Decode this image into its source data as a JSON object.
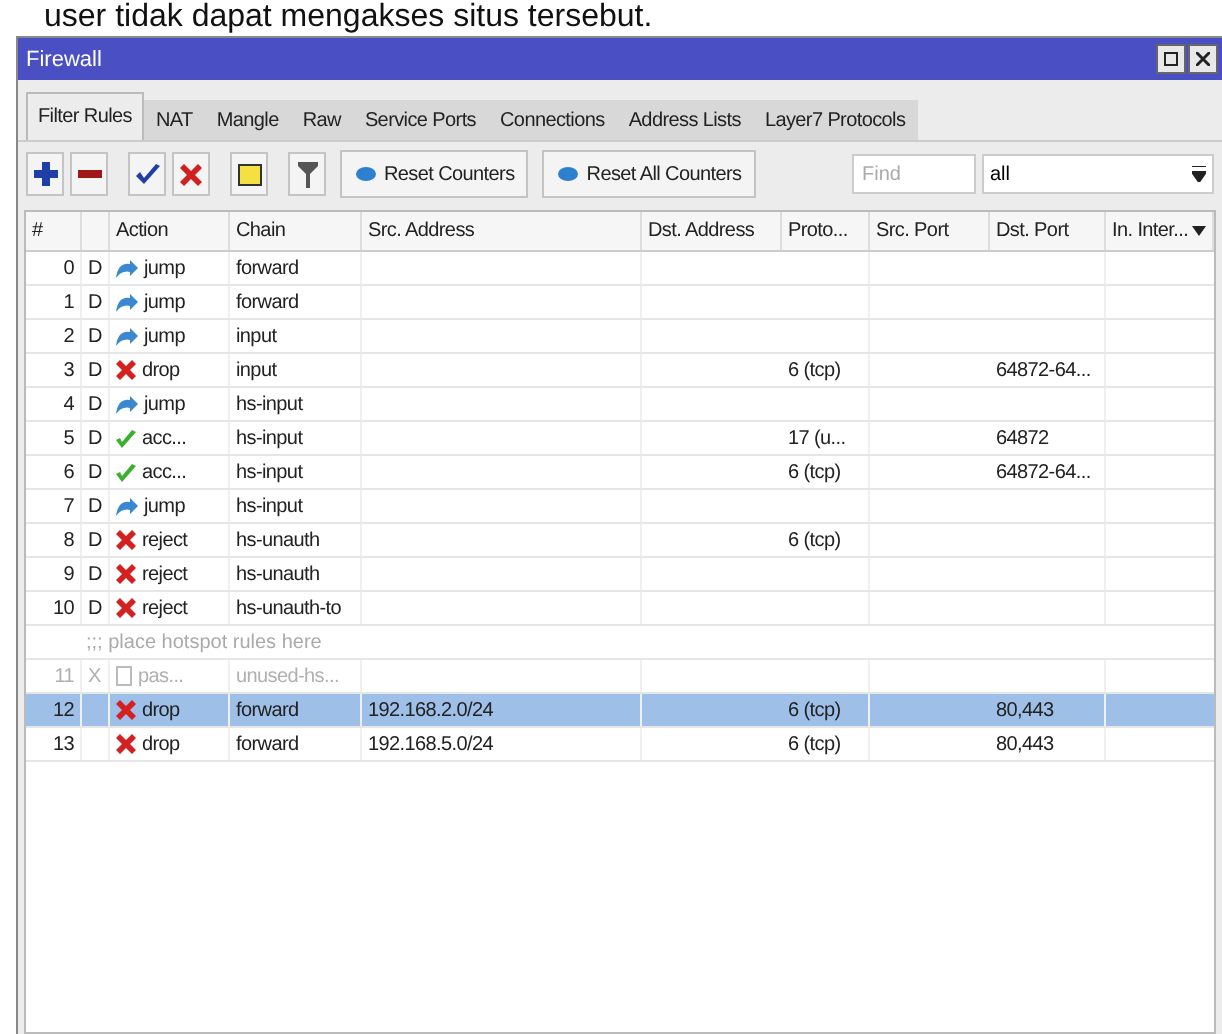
{
  "caption": "user tidak dapat mengakses situs tersebut.",
  "window": {
    "title": "Firewall"
  },
  "tabs": [
    {
      "label": "Filter Rules",
      "selected": true
    },
    {
      "label": "NAT",
      "selected": false
    },
    {
      "label": "Mangle",
      "selected": false
    },
    {
      "label": "Raw",
      "selected": false
    },
    {
      "label": "Service Ports",
      "selected": false
    },
    {
      "label": "Connections",
      "selected": false
    },
    {
      "label": "Address Lists",
      "selected": false
    },
    {
      "label": "Layer7 Protocols",
      "selected": false
    }
  ],
  "toolbar": {
    "tools": [
      {
        "kind": "add"
      },
      {
        "kind": "remove"
      },
      {
        "kind": "enable"
      },
      {
        "kind": "disable"
      },
      {
        "kind": "comment"
      },
      {
        "kind": "filter"
      }
    ],
    "buttons": [
      "Reset Counters",
      "Reset All Counters"
    ],
    "find": {
      "placeholder": "Find"
    },
    "scope": "all"
  },
  "table": {
    "columns": [
      "#",
      "",
      "Action",
      "Chain",
      "Src. Address",
      "Dst. Address",
      "Proto...",
      "Src. Port",
      "Dst. Port",
      "In. Inter..."
    ],
    "rows": [
      {
        "kind": "jump",
        "number": "0",
        "flag": "D",
        "action_text": "jump",
        "chain": "forward",
        "src": "",
        "proto": "",
        "dst_port": "",
        "disabled": false,
        "selected": false
      },
      {
        "kind": "jump",
        "number": "1",
        "flag": "D",
        "action_text": "jump",
        "chain": "forward",
        "src": "",
        "proto": "",
        "dst_port": "",
        "disabled": false,
        "selected": false
      },
      {
        "kind": "jump",
        "number": "2",
        "flag": "D",
        "action_text": "jump",
        "chain": "input",
        "src": "",
        "proto": "",
        "dst_port": "",
        "disabled": false,
        "selected": false
      },
      {
        "kind": "drop",
        "number": "3",
        "flag": "D",
        "action_text": "drop",
        "chain": "input",
        "src": "",
        "proto": "6 (tcp)",
        "dst_port": "64872-64...",
        "disabled": false,
        "selected": false
      },
      {
        "kind": "jump",
        "number": "4",
        "flag": "D",
        "action_text": "jump",
        "chain": "hs-input",
        "src": "",
        "proto": "",
        "dst_port": "",
        "disabled": false,
        "selected": false
      },
      {
        "kind": "accept",
        "number": "5",
        "flag": "D",
        "action_text": "acc...",
        "chain": "hs-input",
        "src": "",
        "proto": "17 (u...",
        "dst_port": "64872",
        "disabled": false,
        "selected": false
      },
      {
        "kind": "accept",
        "number": "6",
        "flag": "D",
        "action_text": "acc...",
        "chain": "hs-input",
        "src": "",
        "proto": "6 (tcp)",
        "dst_port": "64872-64...",
        "disabled": false,
        "selected": false
      },
      {
        "kind": "jump",
        "number": "7",
        "flag": "D",
        "action_text": "jump",
        "chain": "hs-input",
        "src": "",
        "proto": "",
        "dst_port": "",
        "disabled": false,
        "selected": false
      },
      {
        "kind": "reject",
        "number": "8",
        "flag": "D",
        "action_text": "reject",
        "chain": "hs-unauth",
        "src": "",
        "proto": "6 (tcp)",
        "dst_port": "",
        "disabled": false,
        "selected": false
      },
      {
        "kind": "reject",
        "number": "9",
        "flag": "D",
        "action_text": "reject",
        "chain": "hs-unauth",
        "src": "",
        "proto": "",
        "dst_port": "",
        "disabled": false,
        "selected": false
      },
      {
        "kind": "reject",
        "number": "10",
        "flag": "D",
        "action_text": "reject",
        "chain": "hs-unauth-to",
        "src": "",
        "proto": "",
        "dst_port": "",
        "disabled": false,
        "selected": false
      },
      {
        "kind": "comment",
        "text": ";;; place hotspot rules here"
      },
      {
        "kind": "passthrough",
        "number": "11",
        "flag": "X",
        "action_text": "pas...",
        "chain": "unused-hs...",
        "src": "",
        "proto": "",
        "dst_port": "",
        "disabled": true,
        "selected": false
      },
      {
        "kind": "drop",
        "number": "12",
        "flag": "",
        "action_text": "drop",
        "chain": "forward",
        "src": "192.168.2.0/24",
        "proto": "6 (tcp)",
        "dst_port": "80,443",
        "disabled": false,
        "selected": true
      },
      {
        "kind": "drop",
        "number": "13",
        "flag": "",
        "action_text": "drop",
        "chain": "forward",
        "src": "192.168.5.0/24",
        "proto": "6 (tcp)",
        "dst_port": "80,443",
        "disabled": false,
        "selected": false
      }
    ]
  }
}
